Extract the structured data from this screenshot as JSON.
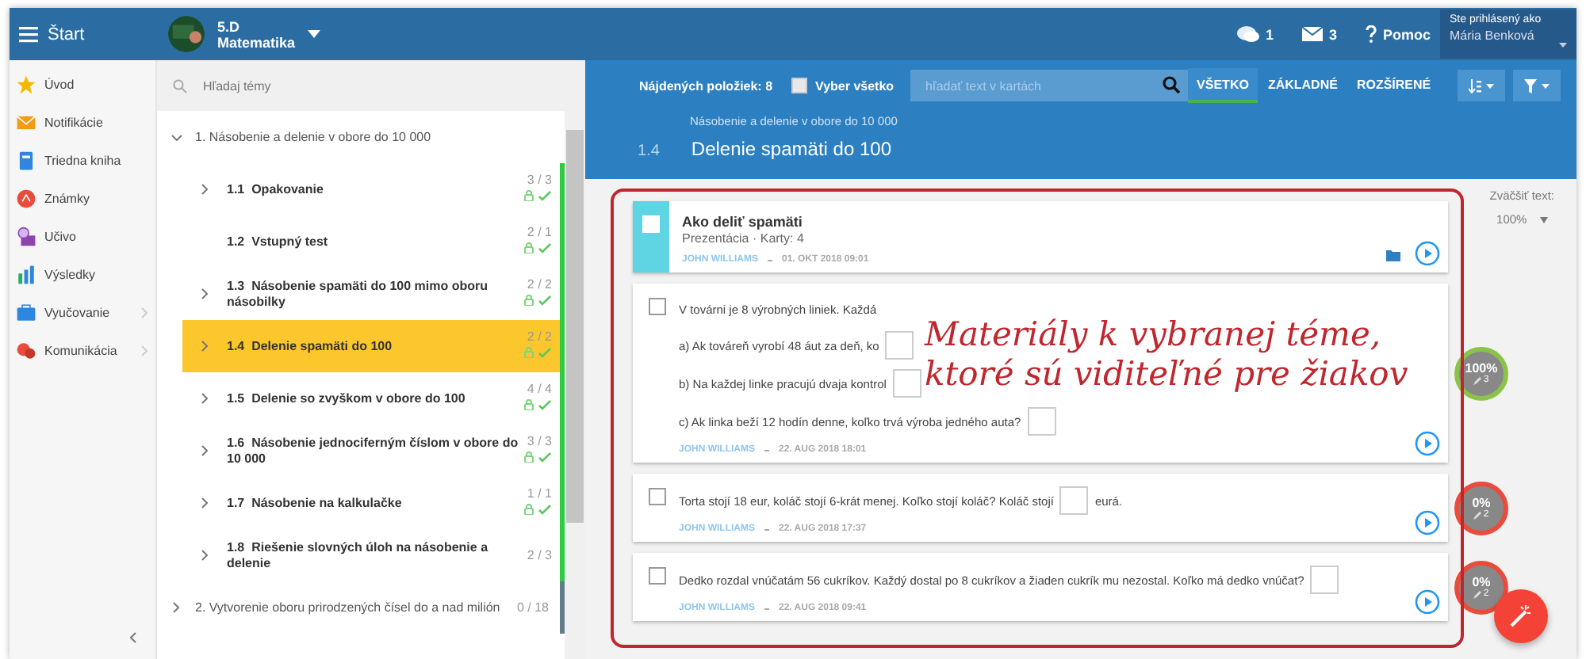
{
  "topbar": {
    "menu_label": "Štart",
    "class_name": "5.D",
    "subject": "Matematika",
    "chat_count": "1",
    "mail_count": "3",
    "help": "Pomoc",
    "user_caption": "Ste prihlásený ako",
    "user_name": "Mária Benková"
  },
  "sidebar": {
    "items": [
      {
        "label": "Úvod",
        "has_children": false
      },
      {
        "label": "Notifikácie",
        "has_children": false
      },
      {
        "label": "Triedna kniha",
        "has_children": false
      },
      {
        "label": "Známky",
        "has_children": false
      },
      {
        "label": "Učivo",
        "has_children": false
      },
      {
        "label": "Výsledky",
        "has_children": false
      },
      {
        "label": "Vyučovanie",
        "has_children": true
      },
      {
        "label": "Komunikácia",
        "has_children": true
      }
    ]
  },
  "topics": {
    "search_placeholder": "Hľadaj témy",
    "items": [
      {
        "label": "1. Násobenie a delenie v obore do 10 000",
        "expanded": true,
        "children": [
          {
            "number": "1.1",
            "title": "Opakovanie",
            "count": "3 / 3",
            "has_children": true,
            "done": true,
            "selected": false,
            "color": "#2ecc40"
          },
          {
            "number": "1.2",
            "title": "Vstupný test",
            "count": "2 / 1",
            "has_children": false,
            "done": true,
            "selected": false,
            "color": "#2ecc40"
          },
          {
            "number": "1.3",
            "title": "Násobenie spamäti do 100 mimo oboru násobilky",
            "count": "2 / 2",
            "has_children": true,
            "done": true,
            "selected": false,
            "color": "#2ecc40"
          },
          {
            "number": "1.4",
            "title": "Delenie spamäti do 100",
            "count": "2 / 2",
            "has_children": true,
            "done": true,
            "selected": true,
            "color": "#2ecc40"
          },
          {
            "number": "1.5",
            "title": "Delenie so zvyškom v obore do 100",
            "count": "4 / 4",
            "has_children": true,
            "done": true,
            "selected": false,
            "color": "#2ecc40"
          },
          {
            "number": "1.6",
            "title": "Násobenie jednociferným číslom v obore do 10 000",
            "count": "3 / 3",
            "has_children": true,
            "done": true,
            "selected": false,
            "color": "#2ecc40"
          },
          {
            "number": "1.7",
            "title": "Násobenie na kalkulačke",
            "count": "1 / 1",
            "has_children": true,
            "done": true,
            "selected": false,
            "color": "#2ecc40"
          },
          {
            "number": "1.8",
            "title": "Riešenie slovných úloh na násobenie a delenie",
            "count": "2 / 3",
            "has_children": true,
            "done": false,
            "selected": false,
            "color": "#2ecc40"
          }
        ]
      },
      {
        "label": "2. Vytvorenie oboru prirodzených čísel do a nad milión",
        "expanded": false,
        "count": "0 / 18",
        "color": "#607d8b"
      }
    ]
  },
  "toolbar": {
    "found": "Nájdených položiek: 8",
    "select_all": {
      "label": "Vyber všetko",
      "checked": false
    },
    "search_placeholder": "hľadať text v kartách",
    "tabs": [
      {
        "label": "VŠETKO",
        "selected": true
      },
      {
        "label": "ZÁKLADNÉ",
        "selected": false
      },
      {
        "label": "ROZŠÍRENÉ",
        "selected": false
      }
    ]
  },
  "header": {
    "breadcrumb": "Násobenie a delenie v obore do 10 000",
    "number": "1.4",
    "title": "Delenie spamäti do 100"
  },
  "zoom": {
    "label": "Zväčšiť text:",
    "value": "100%"
  },
  "cards": [
    {
      "kind": "presentation",
      "checked": false,
      "title": "Ako deliť spamäti",
      "subtitle": "Prezentácia · Karty: 4",
      "author": "JOHN WILLIAMS",
      "date": "01. OKT 2018 09:01"
    },
    {
      "kind": "question",
      "checked": false,
      "lines": [
        {
          "text": "V továrni je 8 výrobných liniek. Každá",
          "answer": false
        },
        {
          "text": "a) Ak továreň vyrobí 48 áut za deň, ko",
          "answer": true
        },
        {
          "text": "b) Na každej linke pracujú dvaja kontrol",
          "answer": true
        },
        {
          "text": "c) Ak linka beží 12 hodín denne, koľko trvá výroba jedného auta?",
          "answer": true
        }
      ],
      "author": "JOHN WILLIAMS",
      "date": "22. AUG 2018 18:01",
      "score": {
        "percent": "100%",
        "attempts": "3",
        "color": "#8bc34a"
      }
    },
    {
      "kind": "question",
      "checked": false,
      "lines": [
        {
          "text": "Torta stojí 18 eur, koláč stojí 6-krát menej. Koľko stojí koláč? Koláč stojí",
          "answer": true,
          "after": "eurá."
        }
      ],
      "author": "JOHN WILLIAMS",
      "date": "22. AUG 2018 17:37",
      "score": {
        "percent": "0%",
        "attempts": "2",
        "color": "#e74c3c"
      }
    },
    {
      "kind": "question",
      "checked": false,
      "lines": [
        {
          "text": "Dedko rozdal vnúčatám 56 cukríkov. Každý dostal po 8 cukríkov a žiaden cukrík mu nezostal. Koľko má dedko vnúčat?",
          "answer": true
        }
      ],
      "author": "JOHN WILLIAMS",
      "date": "22. AUG 2018 09:41",
      "score": {
        "percent": "0%",
        "attempts": "2",
        "color": "#e74c3c"
      }
    }
  ],
  "annotation": {
    "lines": [
      "Materiály k vybranej téme,",
      "ktoré sú viditeľné pre žiakov"
    ]
  }
}
